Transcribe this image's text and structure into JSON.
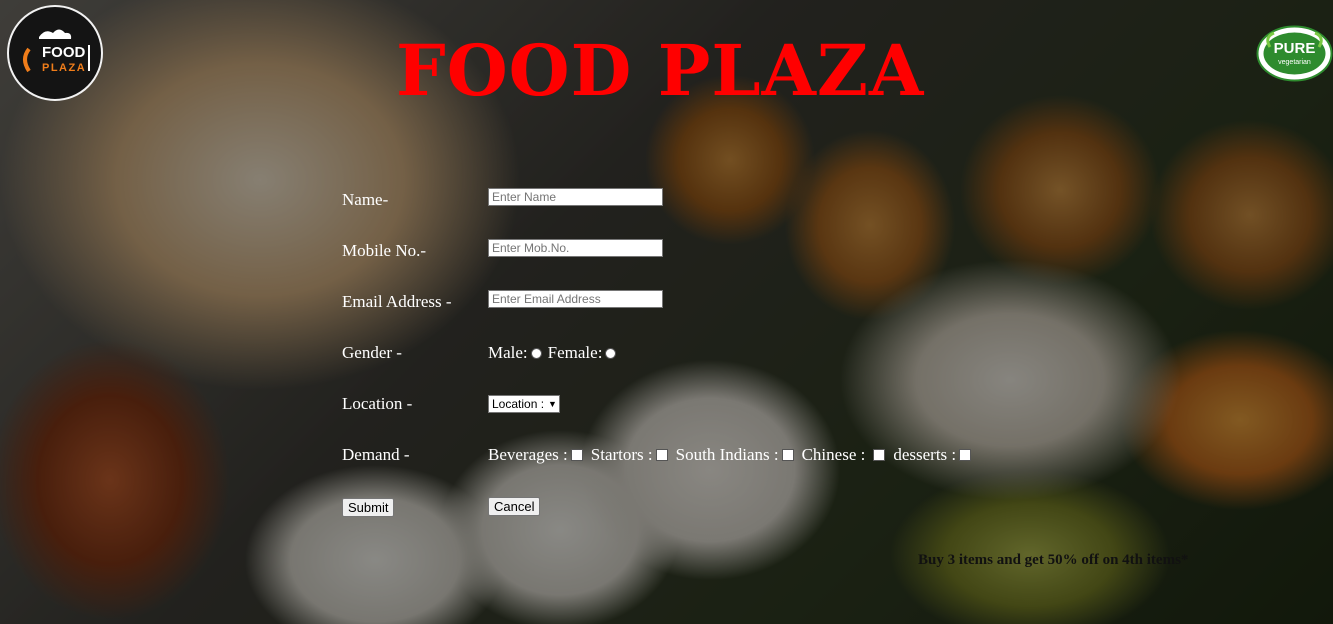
{
  "title": "FOOD PLAZA",
  "logos": {
    "left_text_top": "FOOD",
    "left_text_bottom": "PLAZA",
    "right_text_top": "PURE",
    "right_text_bottom": "vegetarian"
  },
  "form": {
    "name": {
      "label": "Name-",
      "placeholder": "Enter Name"
    },
    "mobile": {
      "label": "Mobile No.-",
      "placeholder": "Enter Mob.No."
    },
    "email": {
      "label": "Email Address -",
      "placeholder": "Enter Email Address"
    },
    "gender": {
      "label": "Gender -",
      "options": [
        "Male:",
        "Female:"
      ]
    },
    "location": {
      "label": "Location -",
      "selected": "Location :"
    },
    "demand": {
      "label": "Demand -",
      "options": [
        "Beverages :",
        "Startors :",
        "South Indians :",
        "Chinese :",
        "desserts :"
      ]
    },
    "submit_label": "Submit",
    "cancel_label": "Cancel"
  },
  "offer": "Buy 3 items and get 50% off on 4th items*",
  "colors": {
    "title": "#ff0000",
    "label_text": "#ffffff",
    "logo_orange": "#f07d1a",
    "logo_green": "#2e8b2e"
  }
}
